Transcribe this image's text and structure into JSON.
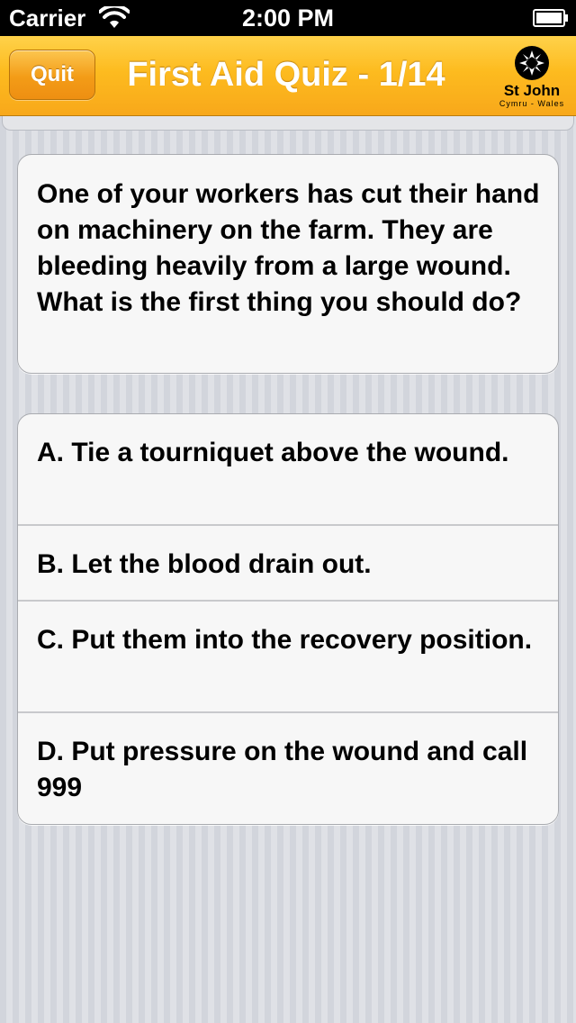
{
  "status_bar": {
    "carrier": "Carrier",
    "time": "2:00 PM",
    "wifi_icon": "wifi-icon",
    "battery_icon": "battery-icon"
  },
  "nav": {
    "quit_label": "Quit",
    "title": "First Aid Quiz - 1/14",
    "accent_color": "#fdbb1f",
    "logo": {
      "icon": "st-john-cross-icon",
      "name": "St John",
      "subtitle": "Cymru - Wales"
    }
  },
  "question": {
    "text": "One of your workers has cut their hand on machinery on the farm. They are bleeding heavily from a large wound. What is the first thing you should do?"
  },
  "answers": [
    {
      "label": "A. Tie a tourniquet above the wound."
    },
    {
      "label": "B. Let the blood drain out."
    },
    {
      "label": "C. Put them into the recovery position."
    },
    {
      "label": "D. Put pressure on the wound and call 999"
    }
  ]
}
